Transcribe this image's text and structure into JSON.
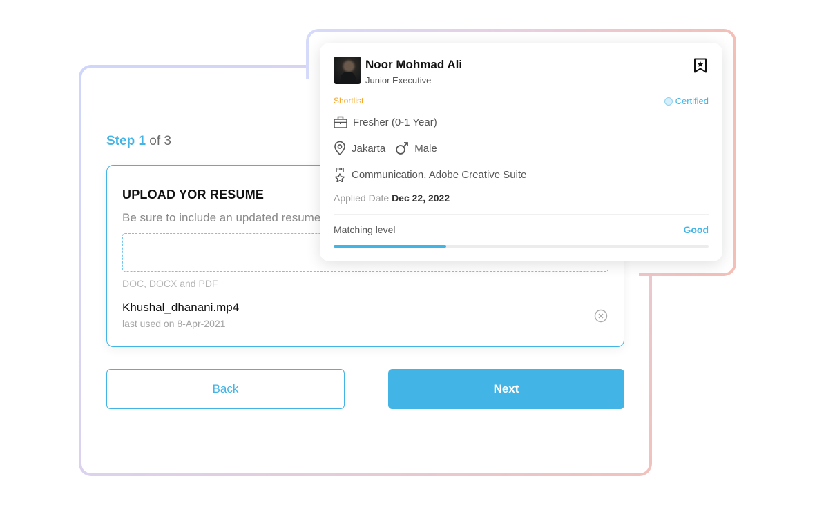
{
  "step": {
    "prefix": "Step 1",
    "suffix": " of 3"
  },
  "upload": {
    "title": "UPLOAD YOR RESUME",
    "description": "Be sure to include an updated resume",
    "formats": "DOC, DOCX and PDF",
    "file": {
      "name": "Khushal_dhanani.mp4",
      "meta": "last used on 8-Apr-2021",
      "remove_icon": "close-circle-icon"
    }
  },
  "buttons": {
    "back": "Back",
    "next": "Next"
  },
  "candidate": {
    "name": "Noor Mohmad Ali",
    "role": "Junior Executive",
    "status": "Shortlist",
    "badge": "Certified",
    "experience": "Fresher (0-1 Year)",
    "location": "Jakarta",
    "gender": "Male",
    "skills": "Communication, Adobe Creative Suite",
    "applied_label": "Applied Date",
    "applied_date": "Dec 22, 2022",
    "matching_label": "Matching level",
    "matching_value": "Good",
    "matching_progress": 0.3
  },
  "colors": {
    "accent": "#42b4e6",
    "shortlist": "#f5a623"
  }
}
